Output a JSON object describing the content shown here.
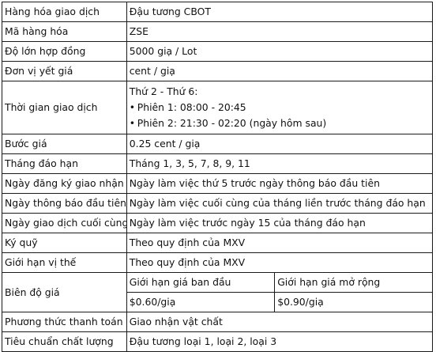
{
  "rows": {
    "commodity": {
      "label": "Hàng hóa giao dịch",
      "value": "Đậu tương CBOT"
    },
    "code": {
      "label": "Mã hàng hóa",
      "value": "ZSE"
    },
    "contract_size": {
      "label": "Độ lớn hợp đồng",
      "value": "5000 giạ / Lot"
    },
    "quote_unit": {
      "label": "Đơn vị yết giá",
      "value": "cent / giạ"
    },
    "trading_hours": {
      "label": "Thời gian giao dịch",
      "days": "Thứ 2 - Thứ 6:",
      "session1": "Phiên 1: 08:00 - 20:45",
      "session2": "Phiên 2: 21:30 - 02:20 (ngày hôm sau)",
      "bullet": "•"
    },
    "tick_size": {
      "label": "Bước giá",
      "value": "0.25 cent / giạ"
    },
    "contract_months": {
      "label": "Tháng đáo hạn",
      "value": "Tháng 1, 3, 5, 7, 8, 9, 11"
    },
    "first_notice_registration": {
      "label": "Ngày đăng ký giao nhận",
      "value": "Ngày làm việc thứ 5 trước ngày thông báo đầu tiên"
    },
    "first_notice_day": {
      "label": "Ngày thông báo đầu tiên",
      "value": "Ngày làm việc cuối cùng của tháng liền trước tháng đáo hạn"
    },
    "last_trading_day": {
      "label": "Ngày giao dịch cuối cùng",
      "value": "Ngày làm việc trước ngày 15 của tháng đáo hạn"
    },
    "margin": {
      "label": "Ký quỹ",
      "value": "Theo quy định của MXV"
    },
    "position_limit": {
      "label": "Giới hạn vị thế",
      "value": "Theo quy định của MXV"
    },
    "price_limit": {
      "label": "Biên độ giá",
      "initial_header": "Giới hạn giá ban đầu",
      "expanded_header": "Giới hạn giá mở rộng",
      "initial_value": "$0.60/giạ",
      "expanded_value": "$0.90/giạ"
    },
    "settlement": {
      "label": "Phương thức thanh toán",
      "value": "Giao nhận vật chất"
    },
    "quality": {
      "label": "Tiêu chuẩn chất lượng",
      "value": "Đậu tương loại 1, loại 2, loại 3"
    }
  }
}
